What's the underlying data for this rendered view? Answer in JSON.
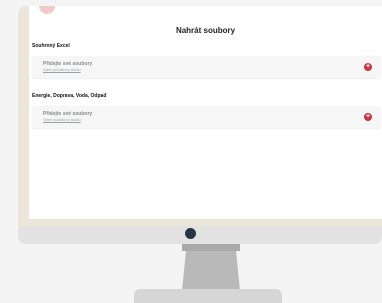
{
  "page": {
    "title": "Nahrát soubory"
  },
  "sections": [
    {
      "label": "Souhrnný Excel",
      "card": {
        "title": "Přidejte své soubory",
        "link": "Vyber počítačový složku",
        "button_icon": "plus-circle-icon"
      }
    },
    {
      "label": "Energie, Doprava, Voda, Odpad",
      "card": {
        "title": "Přidejte své soubory",
        "link": "Vyber počítačový složku",
        "button_icon": "plus-circle-icon"
      }
    }
  ],
  "colors": {
    "accent": "#c93542",
    "screen_bg": "#ffffff",
    "card_bg": "#f6f6f6",
    "bezel": "#ebe6d9"
  }
}
